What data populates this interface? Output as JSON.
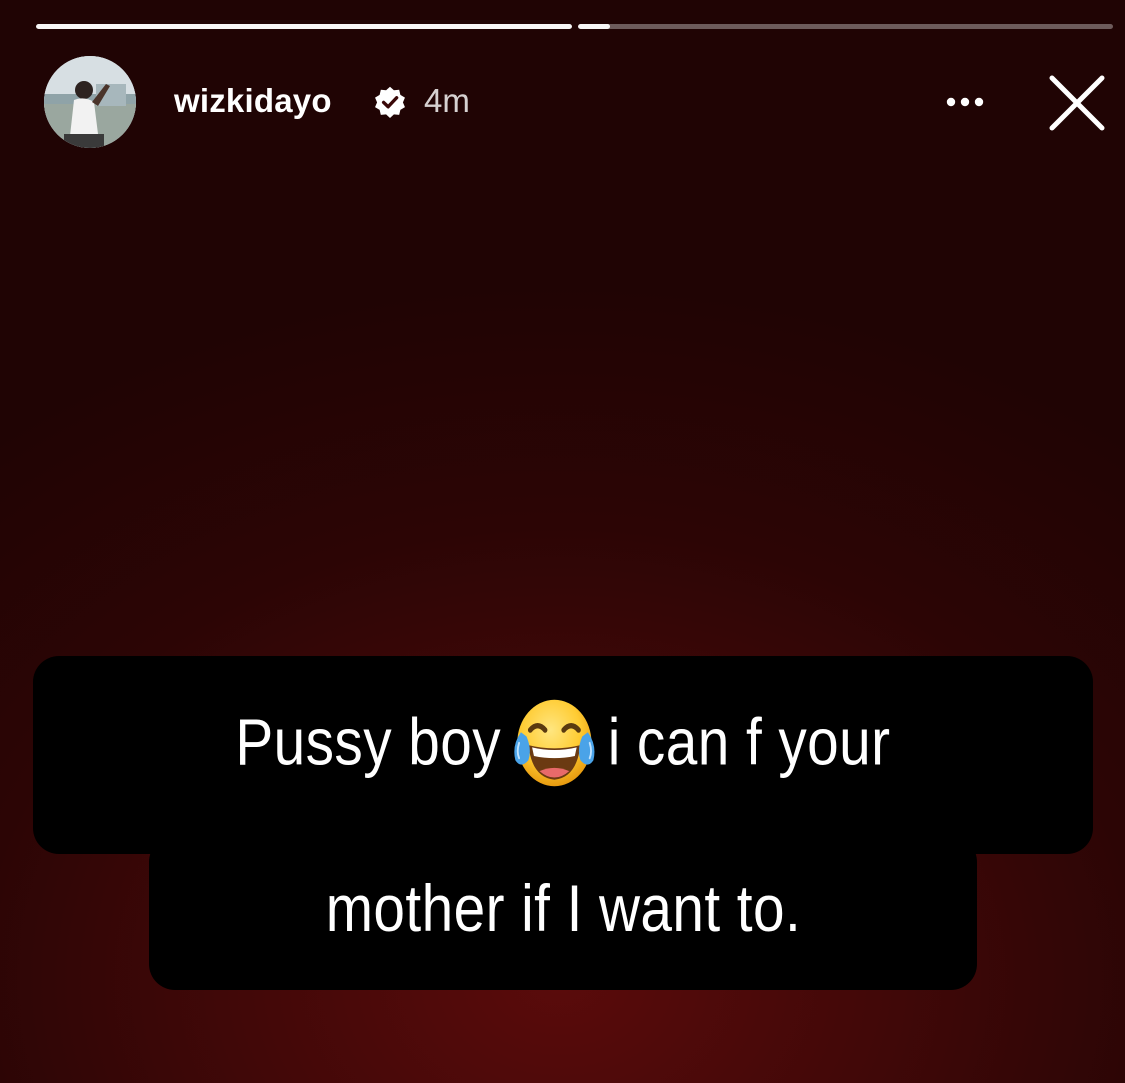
{
  "story": {
    "progress": [
      1.0,
      0.06
    ],
    "user": {
      "username": "wizkidayo",
      "verified": true,
      "timestamp": "4m"
    },
    "icons": {
      "verified": "verified-badge-icon",
      "more": "more-options-icon",
      "close": "close-icon",
      "emoji": "face-with-tears-of-joy-emoji"
    },
    "caption": {
      "line1_before_emoji": "Pussy boy",
      "line1_after_emoji": "i can f your",
      "line2": "mother if I want to."
    },
    "colors": {
      "background": "#3a0707",
      "caption_background": "#000000",
      "caption_text": "#ffffff"
    }
  }
}
